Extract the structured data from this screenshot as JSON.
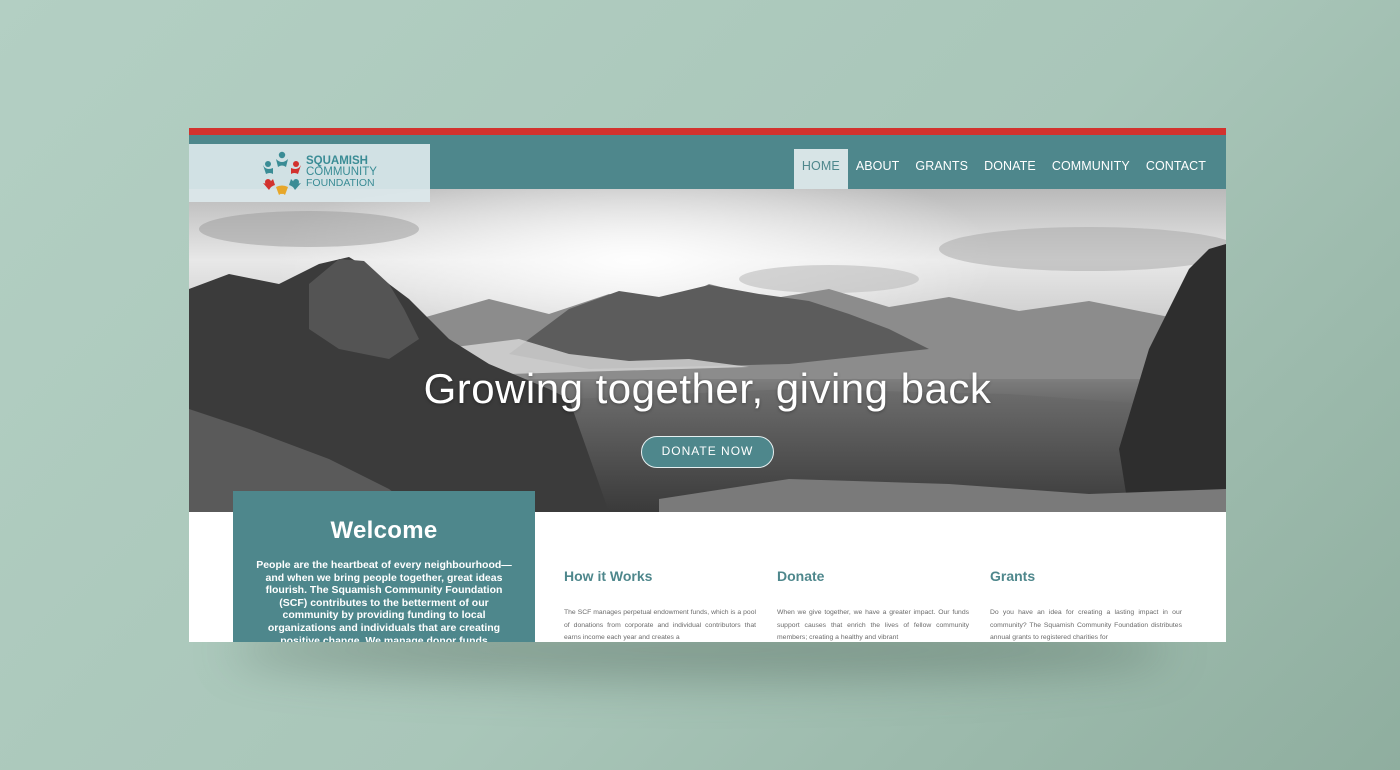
{
  "logo": {
    "line1": "SQUAMISH",
    "line2": "COMMUNITY",
    "line3": "FOUNDATION",
    "colors": [
      "#d2322e",
      "#3a8c95",
      "#e7a72a"
    ]
  },
  "nav": {
    "items": [
      "HOME",
      "ABOUT",
      "GRANTS",
      "DONATE",
      "COMMUNITY",
      "CONTACT"
    ],
    "active": "HOME"
  },
  "hero": {
    "title": "Growing together, giving back",
    "button_label": "DONATE NOW"
  },
  "welcome": {
    "title": "Welcome",
    "body": "People are the heartbeat of every neighbourhood—and when we bring people together, great ideas flourish. The Squamish Community Foundation (SCF) contributes to the betterment of our community by providing funding to local organizations and individuals that are creating positive change. We manage donor funds"
  },
  "columns": [
    {
      "title": "How it Works",
      "body": "The SCF manages perpetual endowment funds, which is a pool of donations from corporate and individual contributors that earns income each year and creates a"
    },
    {
      "title": "Donate",
      "body": "When we give together, we have a greater impact. Our funds support causes that enrich the lives of fellow community members; creating a healthy and vibrant"
    },
    {
      "title": "Grants",
      "body": "Do you have an idea for creating a lasting impact in our community? The Squamish Community Foundation distributes annual grants to registered charities for"
    }
  ],
  "colors": {
    "accent": "#4e878c",
    "topbar": "#d2322e",
    "background": "#b3cfc3"
  }
}
